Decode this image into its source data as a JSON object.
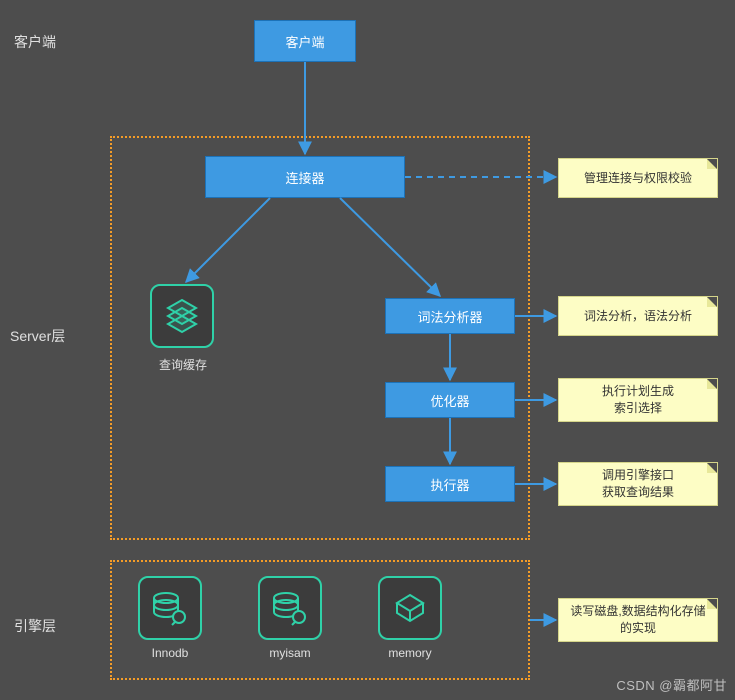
{
  "sections": {
    "client": "客户端",
    "server": "Server层",
    "engine": "引擎层"
  },
  "nodes": {
    "client": "客户端",
    "connector": "连接器",
    "queryCache": "查询缓存",
    "lexer": "词法分析器",
    "optimizer": "优化器",
    "executor": "执行器"
  },
  "notes": {
    "connector": "管理连接与权限校验",
    "lexer": "词法分析，语法分析",
    "optimizer": "执行计划生成\n索引选择",
    "executor": "调用引擎接口\n获取查询结果",
    "engine": "读写磁盘,数据结构化存储的实现"
  },
  "engines": {
    "innodb": "Innodb",
    "myisam": "myisam",
    "memory": "memory"
  },
  "watermark": "CSDN @霸都阿甘",
  "colors": {
    "bg": "#4d4d4d",
    "boxFill": "#3e9ae2",
    "boxBorder": "#1c72b8",
    "dashed": "#f59c27",
    "icon": "#2fd1a8",
    "note": "#fdfdc5"
  }
}
